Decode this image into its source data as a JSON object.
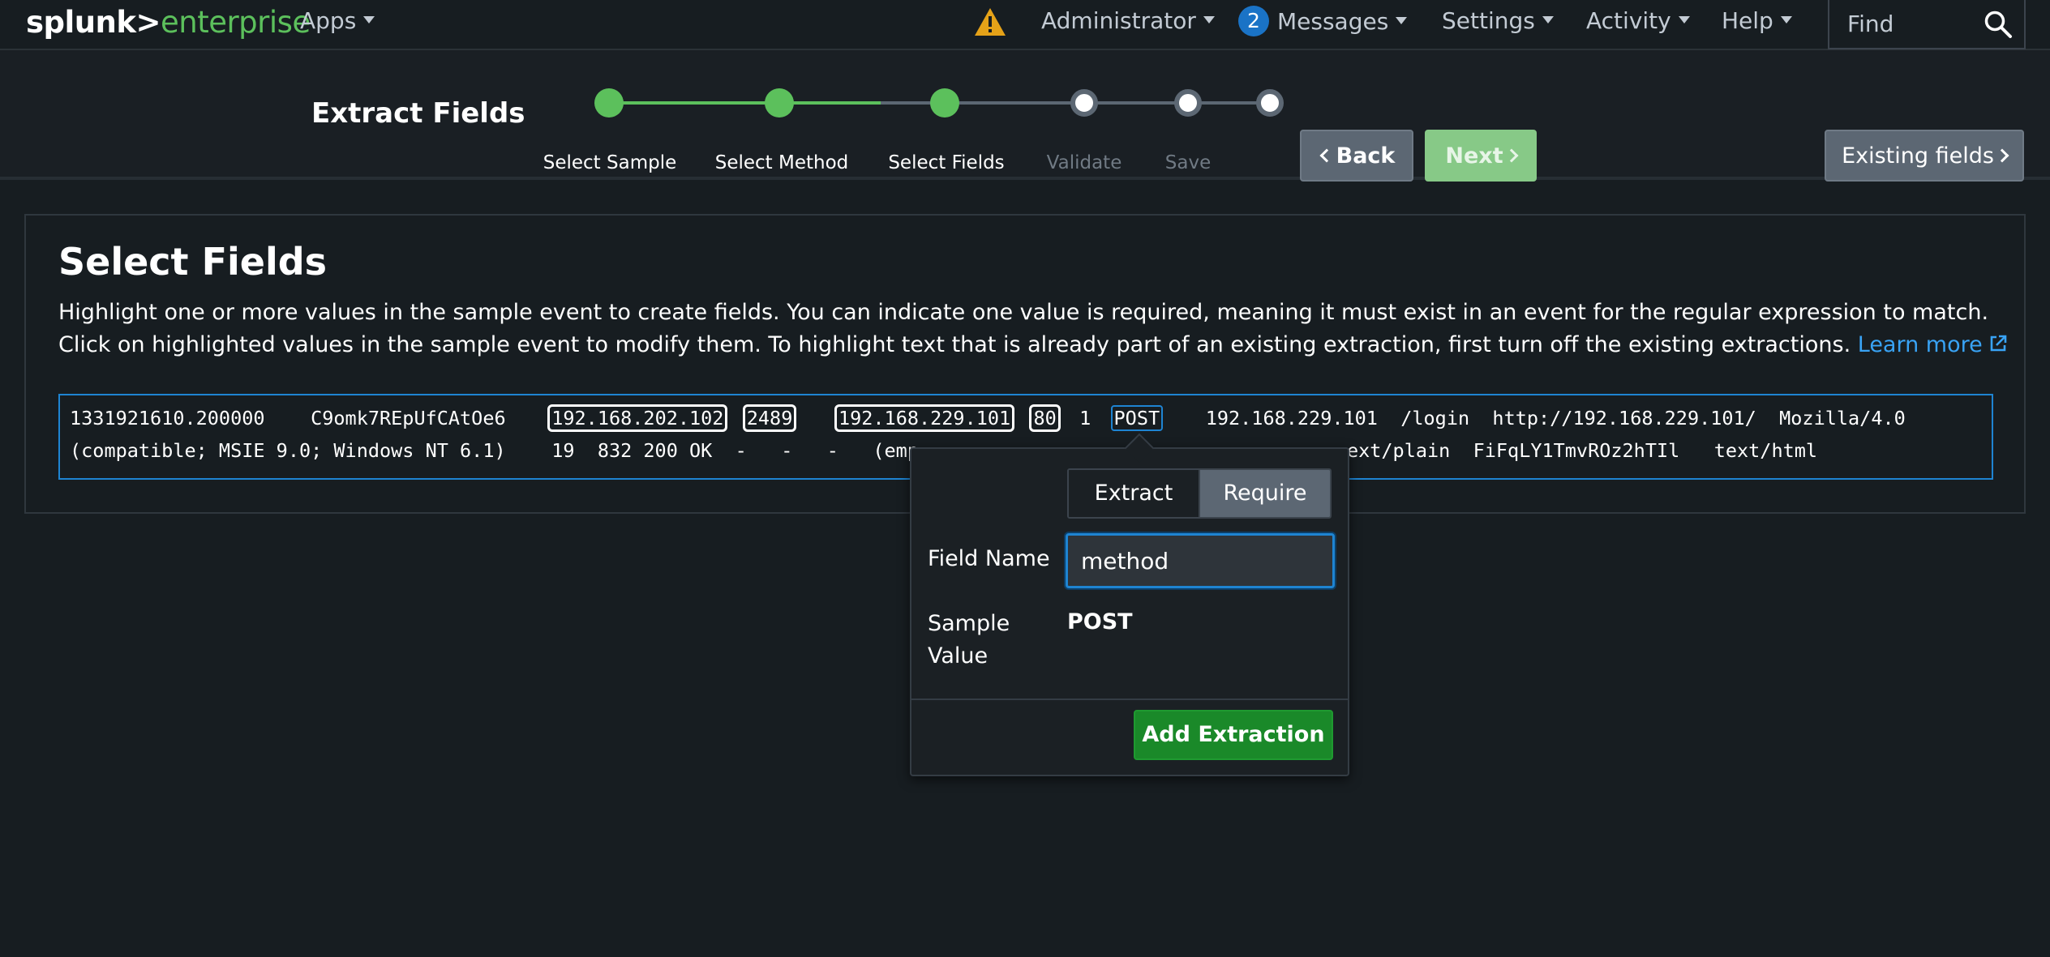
{
  "nav": {
    "logo_white": "splunk>",
    "logo_green": "enterprise",
    "apps": "Apps",
    "administrator": "Administrator",
    "messages_count": "2",
    "messages": "Messages",
    "settings": "Settings",
    "activity": "Activity",
    "help": "Help",
    "find_placeholder": "Find"
  },
  "wizard": {
    "title": "Extract Fields",
    "steps": [
      {
        "label": "Select Sample",
        "state": "done"
      },
      {
        "label": "Select Method",
        "state": "done"
      },
      {
        "label": "Select Fields",
        "state": "done"
      },
      {
        "label": "Validate",
        "state": "todo"
      },
      {
        "label": "Save",
        "state": "todo"
      }
    ],
    "back": "Back",
    "next": "Next",
    "existing": "Existing fields"
  },
  "panel": {
    "title": "Select Fields",
    "description": "Highlight one or more values in the sample event to create fields. You can indicate one value is required, meaning it must exist in an event for the regular expression to match. Click on highlighted values in the sample event to modify them. To highlight text that is already part of an existing extraction, first turn off the existing extractions.",
    "learn_more": "Learn more"
  },
  "event": {
    "l1_a": "1331921610.200000    C9omk7REpUfCAtOe6    ",
    "hl1": "192.168.202.102",
    "hl2": "2489",
    "hl3": "192.168.229.101",
    "hl4": "80",
    "l1_b": "  1  ",
    "hl5": "POST",
    "l1_c": "    192.168.229.101  /login  http://192.168.229.101/  Mozilla/4.0",
    "l2_a": "(compatible; MSIE 9.0; Windows NT 6.1)    19  832 200 OK  -   -   -   (emp",
    "l2_b": "ext/plain  FiFqLY1TmvROz2hTIl   text/html"
  },
  "popover": {
    "extract": "Extract",
    "require": "Require",
    "field_name_label": "Field Name",
    "field_name_value": "method",
    "sample_label_1": "Sample",
    "sample_label_2": "Value",
    "sample_value": "POST",
    "add": "Add Extraction"
  },
  "colors": {
    "accent_green": "#5cc05c",
    "link_blue": "#39a3f5",
    "focus_blue": "#1e84d2",
    "add_green": "#1a8929",
    "warning": "#e5a218"
  }
}
